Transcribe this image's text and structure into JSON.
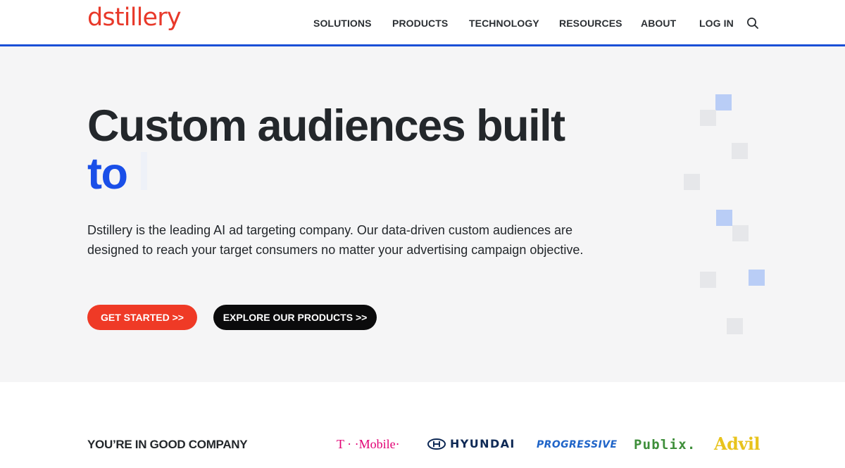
{
  "header": {
    "logo": "dstillery",
    "nav": [
      {
        "label": "SOLUTIONS"
      },
      {
        "label": "PRODUCTS"
      },
      {
        "label": "TECHNOLOGY"
      },
      {
        "label": "RESOURCES"
      },
      {
        "label": "ABOUT"
      },
      {
        "label": "LOG IN"
      }
    ],
    "search_icon": "search-icon"
  },
  "hero": {
    "headline": "Custom audiences built",
    "headline_accent": "to",
    "description": "Dstillery is the leading AI ad targeting company. Our data-driven custom audiences are designed to reach your target consumers no matter your advertising campaign objective.",
    "primary_button": "GET STARTED >>",
    "secondary_button": "EXPLORE OUR PRODUCTS >>"
  },
  "company": {
    "heading": "YOU’RE IN GOOD COMPANY",
    "logos": {
      "tmobile": "T · ·Mobile·",
      "hyundai": "HYUNDAI",
      "progressive": "PROGRESSIVE",
      "publix": "Publix.",
      "advil": "Advil"
    }
  },
  "colors": {
    "brand_red": "#e8392a",
    "accent_blue": "#1a4fe8",
    "header_rule": "#1a4fd6",
    "button_primary": "#ef3a26",
    "button_secondary": "#0b0b0c",
    "hero_bg": "#f5f5f6"
  }
}
